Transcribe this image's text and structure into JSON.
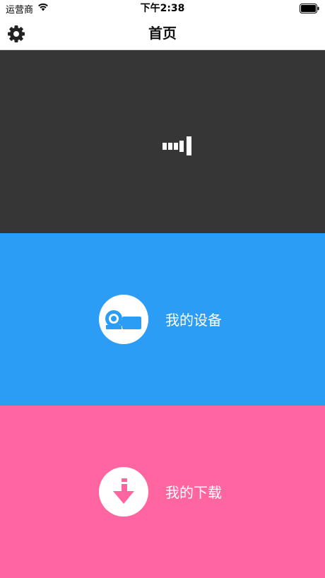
{
  "status_bar": {
    "carrier": "运营商",
    "time": "下午2:38"
  },
  "nav": {
    "title": "首页",
    "settings_icon": "gear-icon"
  },
  "video_panel": {
    "background": "#363636",
    "loading_icon": "loading-bars-icon"
  },
  "tiles": [
    {
      "label": "我的设备",
      "icon": "camcorder-icon",
      "color": "#2b9df5"
    },
    {
      "label": "我的下载",
      "icon": "download-arrow-icon",
      "color": "#ff65a1"
    }
  ]
}
